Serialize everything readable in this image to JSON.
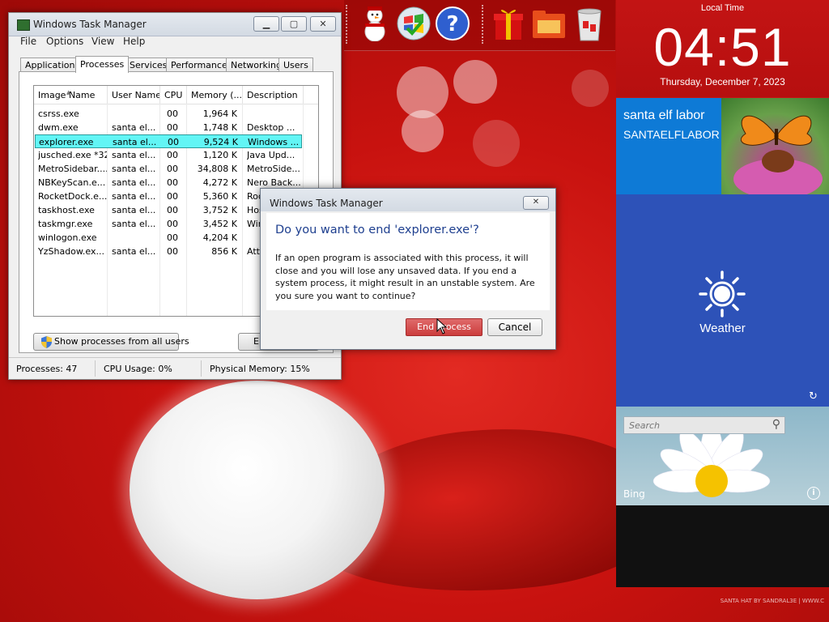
{
  "task_manager": {
    "title": "Windows Task Manager",
    "menu": [
      "File",
      "Options",
      "View",
      "Help"
    ],
    "tabs": [
      "Applications",
      "Processes",
      "Services",
      "Performance",
      "Networking",
      "Users"
    ],
    "active_tab": "Processes",
    "columns": [
      "Image Name",
      "User Name",
      "CPU",
      "Memory (...",
      "Description"
    ],
    "processes": [
      {
        "name": "csrss.exe",
        "user": "",
        "cpu": "00",
        "mem": "1,964 K",
        "desc": ""
      },
      {
        "name": "dwm.exe",
        "user": "santa el...",
        "cpu": "00",
        "mem": "1,748 K",
        "desc": "Desktop ..."
      },
      {
        "name": "explorer.exe",
        "user": "santa el...",
        "cpu": "00",
        "mem": "9,524 K",
        "desc": "Windows ..."
      },
      {
        "name": "jusched.exe *32",
        "user": "santa el...",
        "cpu": "00",
        "mem": "1,120 K",
        "desc": "Java Upd..."
      },
      {
        "name": "MetroSidebar....",
        "user": "santa el...",
        "cpu": "00",
        "mem": "34,808 K",
        "desc": "MetroSide..."
      },
      {
        "name": "NBKeyScan.e...",
        "user": "santa el...",
        "cpu": "00",
        "mem": "4,272 K",
        "desc": "Nero Back..."
      },
      {
        "name": "RocketDock.e...",
        "user": "santa el...",
        "cpu": "00",
        "mem": "5,360 K",
        "desc": "Roc"
      },
      {
        "name": "taskhost.exe",
        "user": "santa el...",
        "cpu": "00",
        "mem": "3,752 K",
        "desc": "Hos"
      },
      {
        "name": "taskmgr.exe",
        "user": "santa el...",
        "cpu": "00",
        "mem": "3,452 K",
        "desc": "Win"
      },
      {
        "name": "winlogon.exe",
        "user": "",
        "cpu": "00",
        "mem": "4,204 K",
        "desc": ""
      },
      {
        "name": "YzShadow.ex...",
        "user": "santa el...",
        "cpu": "00",
        "mem": "856 K",
        "desc": "Att"
      }
    ],
    "selected_process": "explorer.exe",
    "show_all_label": "Show processes from all users",
    "end_button_partial": "E",
    "status": {
      "processes": "Processes: 47",
      "cpu": "CPU Usage: 0%",
      "memory": "Physical Memory: 15%"
    }
  },
  "dialog": {
    "title": "Windows Task Manager",
    "heading": "Do you want to end 'explorer.exe'?",
    "message": "If an open program is associated with this process, it will close and you will lose any unsaved data. If you end a system process, it might result in an unstable system. Are you sure you want to continue?",
    "end_button": "End process",
    "cancel_button": "Cancel"
  },
  "sidebar": {
    "clock_label": "Local Time",
    "time": "04:51",
    "date": "Thursday, December 7, 2023",
    "user_name": "santa elf labor",
    "user_id": "SANTAELFLABOR",
    "weather_label": "Weather",
    "search_placeholder": "Search",
    "bing_label": "Bing"
  },
  "background": {
    "credit": "SANTA HAT BY SANDRAL3E | WWW.C"
  },
  "colors": {
    "accent_red": "#c51414",
    "tile_blue": "#0e7ad6",
    "weather_blue": "#2d52b8",
    "selection": "#62f5f5",
    "end_button": "#cc3d3d"
  },
  "dock_icons": [
    "snowman-icon",
    "windows-orb-icon",
    "help-icon",
    "gift-icon",
    "folder-icon",
    "recycle-bin-icon"
  ]
}
